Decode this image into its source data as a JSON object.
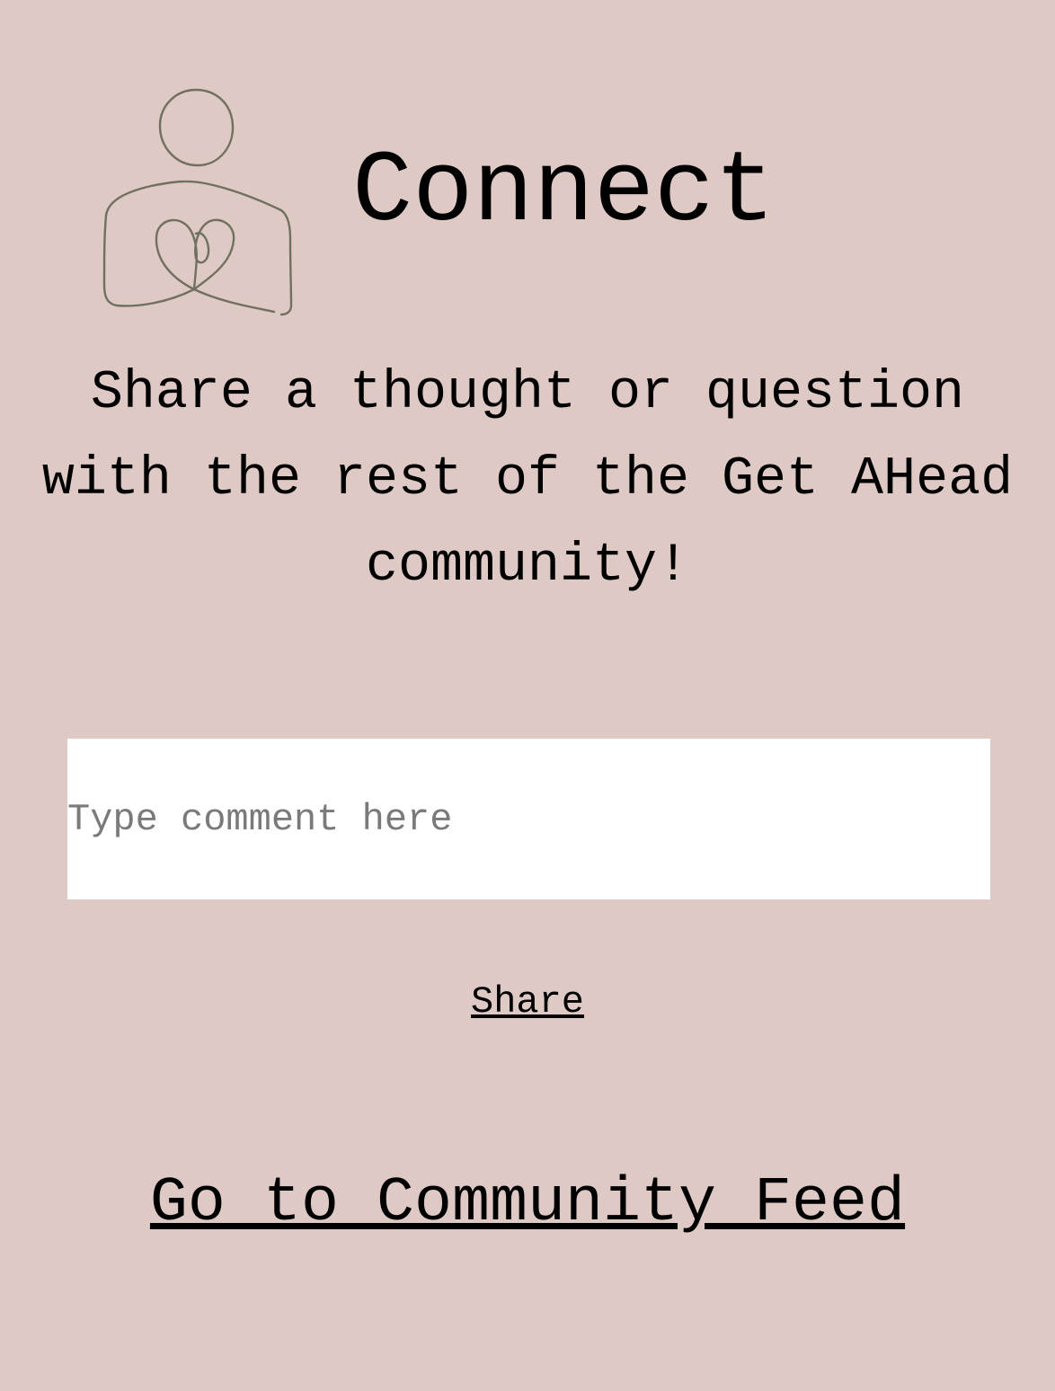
{
  "header": {
    "title": "Connect",
    "logo_icon": "person-heart-icon",
    "logo_stroke_color": "#707060"
  },
  "intro": {
    "text": "Share a thought or question with the rest of the Get AHead community!"
  },
  "comment_form": {
    "placeholder": "Type comment here",
    "value": "",
    "share_label": "Share"
  },
  "footer": {
    "feed_link_label": "Go to Community Feed"
  },
  "colors": {
    "background": "#dfc9c5",
    "input_background": "#ffffff",
    "text": "#000000",
    "placeholder": "#7a7a7a"
  }
}
